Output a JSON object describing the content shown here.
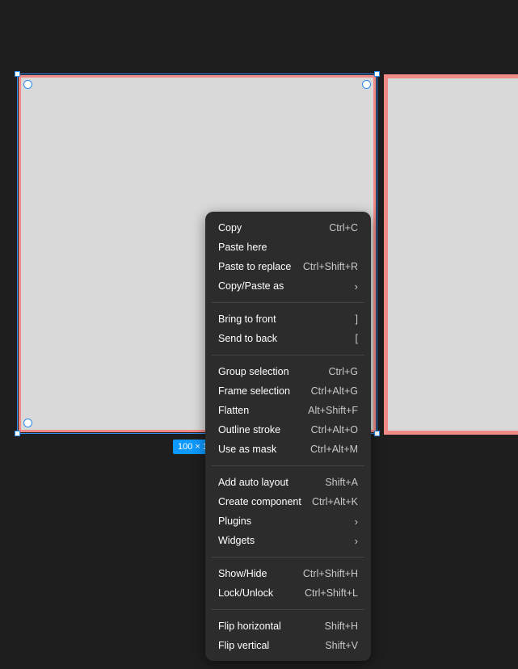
{
  "canvas": {
    "background": "#1e1e1e",
    "frame_fill": "#d9d9d9",
    "frame_stroke": "#f08a86",
    "selection_color": "#2f8cf0",
    "size_badge_text": "100 × 1"
  },
  "menu": {
    "groups": [
      [
        {
          "label": "Copy",
          "shortcut": "Ctrl+C"
        },
        {
          "label": "Paste here",
          "shortcut": ""
        },
        {
          "label": "Paste to replace",
          "shortcut": "Ctrl+Shift+R"
        },
        {
          "label": "Copy/Paste as",
          "shortcut": "›"
        }
      ],
      [
        {
          "label": "Bring to front",
          "shortcut": "]"
        },
        {
          "label": "Send to back",
          "shortcut": "["
        }
      ],
      [
        {
          "label": "Group selection",
          "shortcut": "Ctrl+G"
        },
        {
          "label": "Frame selection",
          "shortcut": "Ctrl+Alt+G"
        },
        {
          "label": "Flatten",
          "shortcut": "Alt+Shift+F"
        },
        {
          "label": "Outline stroke",
          "shortcut": "Ctrl+Alt+O"
        },
        {
          "label": "Use as mask",
          "shortcut": "Ctrl+Alt+M"
        }
      ],
      [
        {
          "label": "Add auto layout",
          "shortcut": "Shift+A"
        },
        {
          "label": "Create component",
          "shortcut": "Ctrl+Alt+K"
        },
        {
          "label": "Plugins",
          "shortcut": "›"
        },
        {
          "label": "Widgets",
          "shortcut": "›"
        }
      ],
      [
        {
          "label": "Show/Hide",
          "shortcut": "Ctrl+Shift+H"
        },
        {
          "label": "Lock/Unlock",
          "shortcut": "Ctrl+Shift+L"
        }
      ],
      [
        {
          "label": "Flip horizontal",
          "shortcut": "Shift+H"
        },
        {
          "label": "Flip vertical",
          "shortcut": "Shift+V"
        }
      ]
    ]
  }
}
